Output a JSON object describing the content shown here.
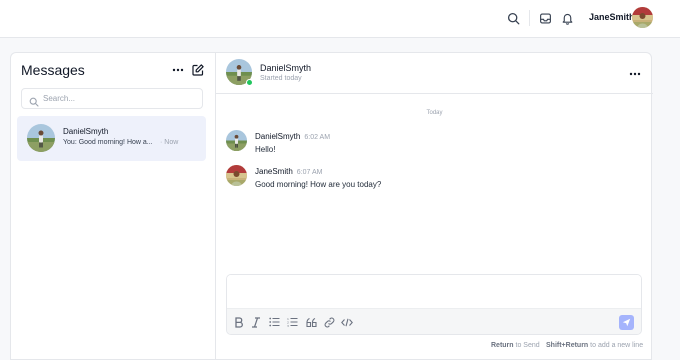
{
  "header": {
    "username": "JaneSmith",
    "icons": [
      "search-icon",
      "inbox-icon",
      "bell-icon"
    ]
  },
  "sidebar": {
    "title": "Messages",
    "search_placeholder": "Search...",
    "conversations": [
      {
        "name": "DanielSmyth",
        "preview": "You: Good morning! How a...",
        "separator": "·",
        "time": "Now"
      }
    ]
  },
  "chat": {
    "header": {
      "name": "DanielSmyth",
      "subtitle": "Started today"
    },
    "day_divider": "Today",
    "messages": [
      {
        "author": "DanielSmyth",
        "time": "6:02 AM",
        "text": "Hello!"
      },
      {
        "author": "JaneSmith",
        "time": "6:07 AM",
        "text": "Good morning! How are you today?"
      }
    ],
    "composer": {
      "toolbar_icons": [
        "bold-icon",
        "italic-icon",
        "bullet-list-icon",
        "numbered-list-icon",
        "quote-icon",
        "link-icon",
        "code-icon",
        "send-icon"
      ],
      "hint_key1": "Return",
      "hint_text1": "to Send",
      "hint_key2": "Shift+Return",
      "hint_text2": "to add a new line"
    }
  },
  "colors": {
    "accent": "#a5b4fc",
    "selected_bg": "#eef1fb",
    "online": "#22c55e"
  }
}
